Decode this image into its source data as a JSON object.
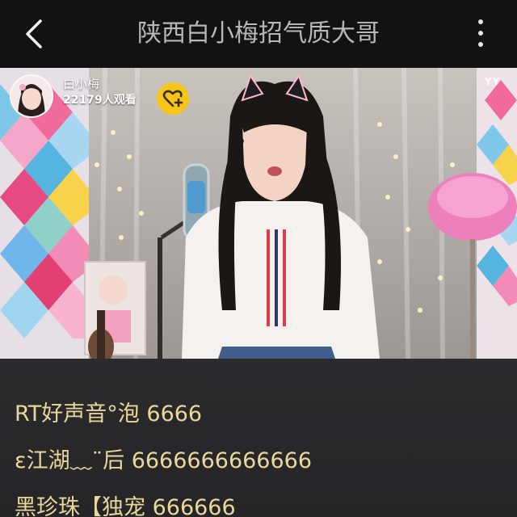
{
  "header": {
    "title": "陕西白小梅招气质大哥",
    "back_icon": "back-arrow-icon",
    "more_icon": "more-vertical-icon"
  },
  "stream": {
    "host_name": "白小梅",
    "viewers_text": "22179人观看",
    "follow_icon": "heart-plus-icon",
    "watermark": "YY"
  },
  "chat": [
    {
      "user": "RT好声音°泡",
      "text": "6666"
    },
    {
      "user": "ε江湖﹏¨后",
      "text": "6666666666666"
    },
    {
      "user": "黑珍珠【独宠",
      "text": "666666"
    }
  ],
  "colors": {
    "accent": "#f5c518",
    "chat_text": "#ead79a",
    "topbar": "#121212"
  }
}
